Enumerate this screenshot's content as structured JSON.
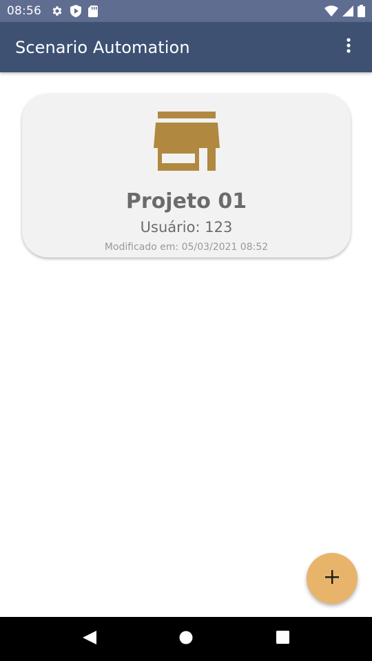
{
  "status_bar": {
    "time": "08:56",
    "left_icons": [
      "gear-icon",
      "shield-play-icon",
      "sd-card-icon"
    ],
    "right_icons": [
      "wifi-icon",
      "signal-icon",
      "battery-icon"
    ],
    "background": "#5f6d91"
  },
  "app_bar": {
    "title": "Scenario Automation",
    "background": "#3e5173",
    "overflow_icon": "more-vert-icon"
  },
  "projects": [
    {
      "icon": "storefront-icon",
      "icon_color": "#b08840",
      "name": "Projeto 01",
      "user": "Usuário: 123",
      "modified": "Modificado em: 05/03/2021 08:52"
    }
  ],
  "fab": {
    "icon": "plus-icon",
    "color": "#e8b46c"
  },
  "nav_bar": {
    "buttons": [
      "back-icon",
      "home-icon",
      "recents-icon"
    ]
  }
}
